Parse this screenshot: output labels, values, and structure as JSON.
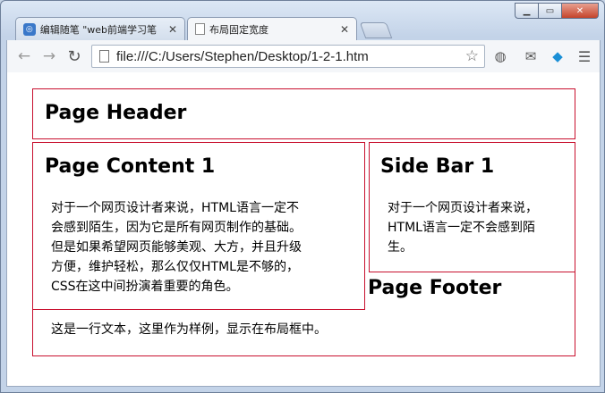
{
  "browser": {
    "tabs": [
      {
        "label": "编辑随笔 \"web前端学习笔",
        "favicon": "blog-icon",
        "active": false
      },
      {
        "label": "布局固定宽度",
        "favicon": "page-icon",
        "active": true
      }
    ],
    "url": "file:///C:/Users/Stephen/Desktop/1-2-1.htm"
  },
  "page": {
    "header": {
      "title": "Page Header"
    },
    "content": {
      "title": "Page Content 1",
      "paragraph_lines": [
        "对于一个网页设计者来说，HTML语言一定不",
        "会感到陌生，因为它是所有网页制作的基础。",
        "但是如果希望网页能够美观、大方，并且升级",
        "方便，维护轻松，那么仅仅HTML是不够的，",
        "CSS在这中间扮演着重要的角色。"
      ]
    },
    "sidebar": {
      "title": "Side Bar 1",
      "paragraph_lines": [
        "对于一个网页设计者来说，",
        "HTML语言一定不会感到陌",
        "生。"
      ]
    },
    "footer": {
      "title": "Page Footer",
      "text": "这是一行文本，这里作为样例，显示在布局框中。"
    }
  },
  "colors": {
    "box_border": "#c8102e"
  }
}
